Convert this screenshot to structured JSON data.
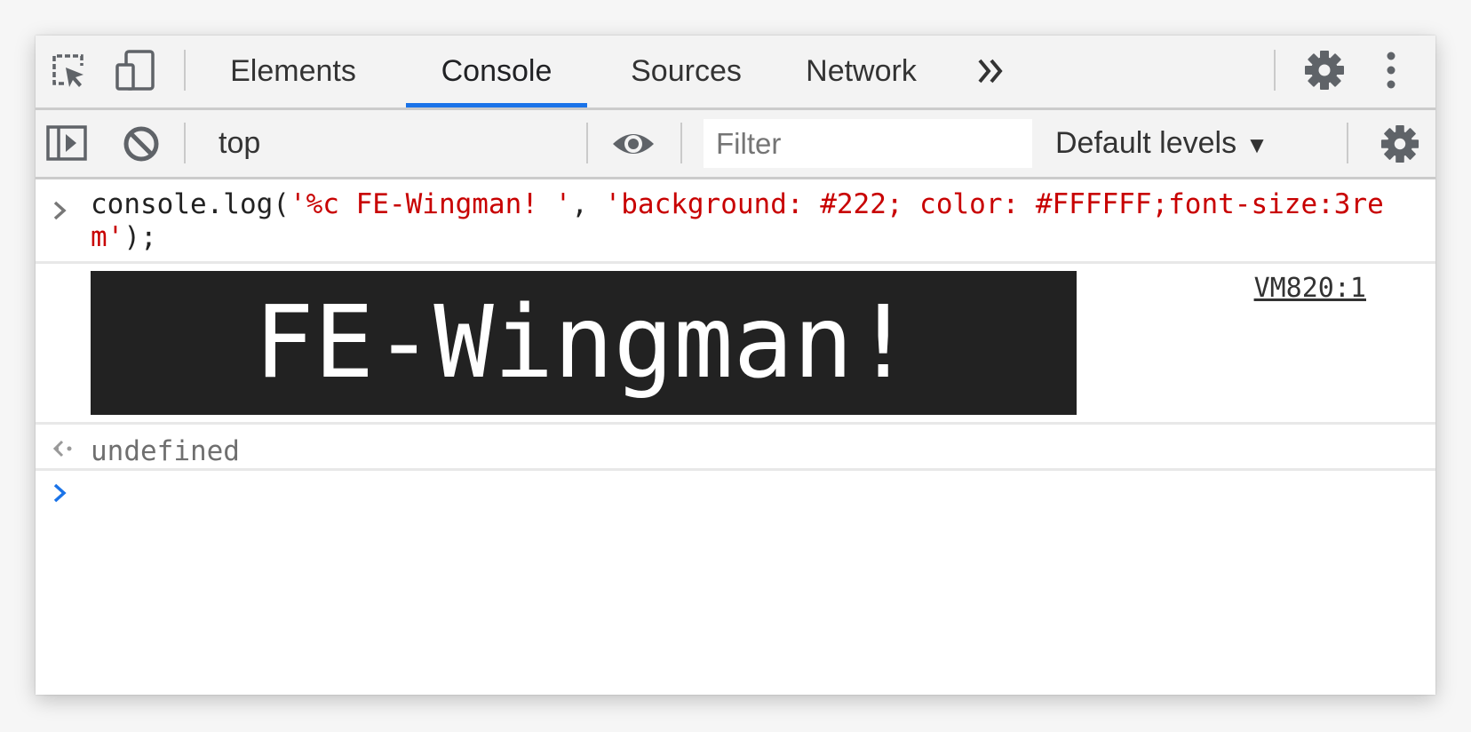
{
  "tabs": [
    {
      "label": "Elements"
    },
    {
      "label": "Console"
    },
    {
      "label": "Sources"
    },
    {
      "label": "Network"
    }
  ],
  "active_tab": "Console",
  "icons": {
    "inspect": "inspect-element-icon",
    "device": "device-toolbar-icon",
    "more_tabs": "double-chevron-icon",
    "settings": "gear-icon",
    "menu": "vertical-dots-icon",
    "sidebar": "sidebar-toggle-icon",
    "clear": "clear-console-icon",
    "live_expression": "eye-icon",
    "console_settings": "gear-icon"
  },
  "toolbar": {
    "context": "top",
    "filter_placeholder": "Filter",
    "levels": "Default levels"
  },
  "console": {
    "input_parts": {
      "pre": "console.log(",
      "arg1": "'%c FE-Wingman! '",
      "sep": ", ",
      "arg2": "'background: #222; color: #FFFFFF;font-size:3rem'",
      "post": ");"
    },
    "styled_output": " FE-Wingman! ",
    "source_link": "VM820:1",
    "return_value": "undefined"
  },
  "colors": {
    "accent": "#1a73e8",
    "string": "#c80000",
    "styled_bg": "#222222",
    "styled_fg": "#FFFFFF"
  }
}
